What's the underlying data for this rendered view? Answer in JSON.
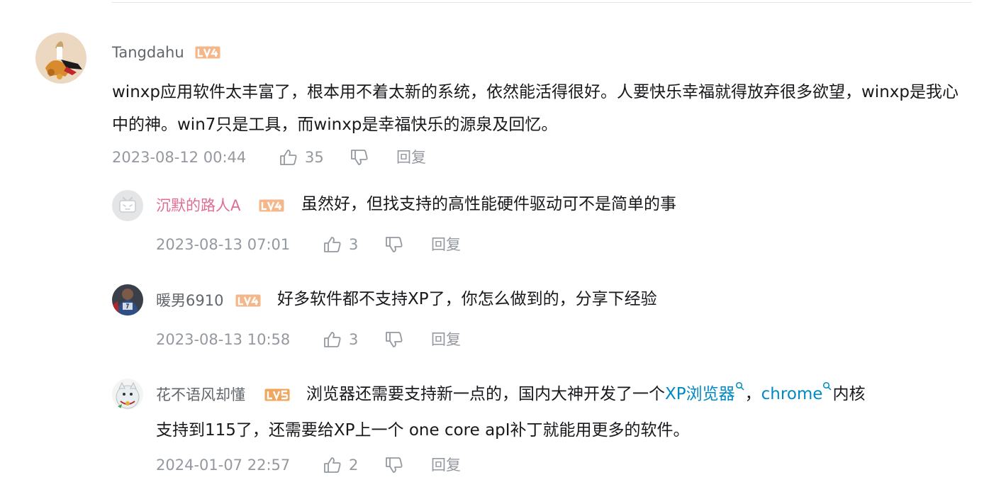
{
  "colors": {
    "text": "#18191c",
    "meta": "#9499a0",
    "level_badge": "#f3b78a",
    "level_badge_alt": "#f1a55d",
    "vip_name": "#e06d94",
    "link": "#008ac5"
  },
  "root_comment": {
    "username": "Tangdahu",
    "level": "LV4",
    "content": "winxp应用软件太丰富了，根本用不着太新的系统，依然能活得很好。人要快乐幸福就得放弃很多欲望，winxp是我心中的神。win7只是工具，而winxp是幸福快乐的源泉及回忆。",
    "time": "2023-08-12 00:44",
    "likes": "35",
    "reply_label": "回复",
    "icons": [
      "like-icon",
      "dislike-icon"
    ]
  },
  "replies": [
    {
      "username": "沉默的路人A",
      "level": "LV4",
      "content": "虽然好，但找支持的高性能硬件驱动可不是简单的事",
      "time": "2023-08-13 07:01",
      "likes": "3",
      "reply_label": "回复",
      "avatar": "default-tv-avatar"
    },
    {
      "username": "暖男6910",
      "level": "LV4",
      "content": "好多软件都不支持XP了，你怎么做到的，分享下经验",
      "time": "2023-08-13 10:58",
      "likes": "3",
      "reply_label": "回复"
    },
    {
      "username": "花不语风却懂",
      "level": "LV5",
      "content_parts": {
        "seg1": "浏览器还需要支持新一点的，国内大神开发了一个",
        "link1": "XP浏览器",
        "seg2": "，",
        "link2": "chrome",
        "seg3": "内核",
        "line2": "支持到115了，还需要给XP上一个 one core apI补丁就能用更多的软件。"
      },
      "time": "2024-01-07 22:57",
      "likes": "2",
      "reply_label": "回复"
    }
  ]
}
